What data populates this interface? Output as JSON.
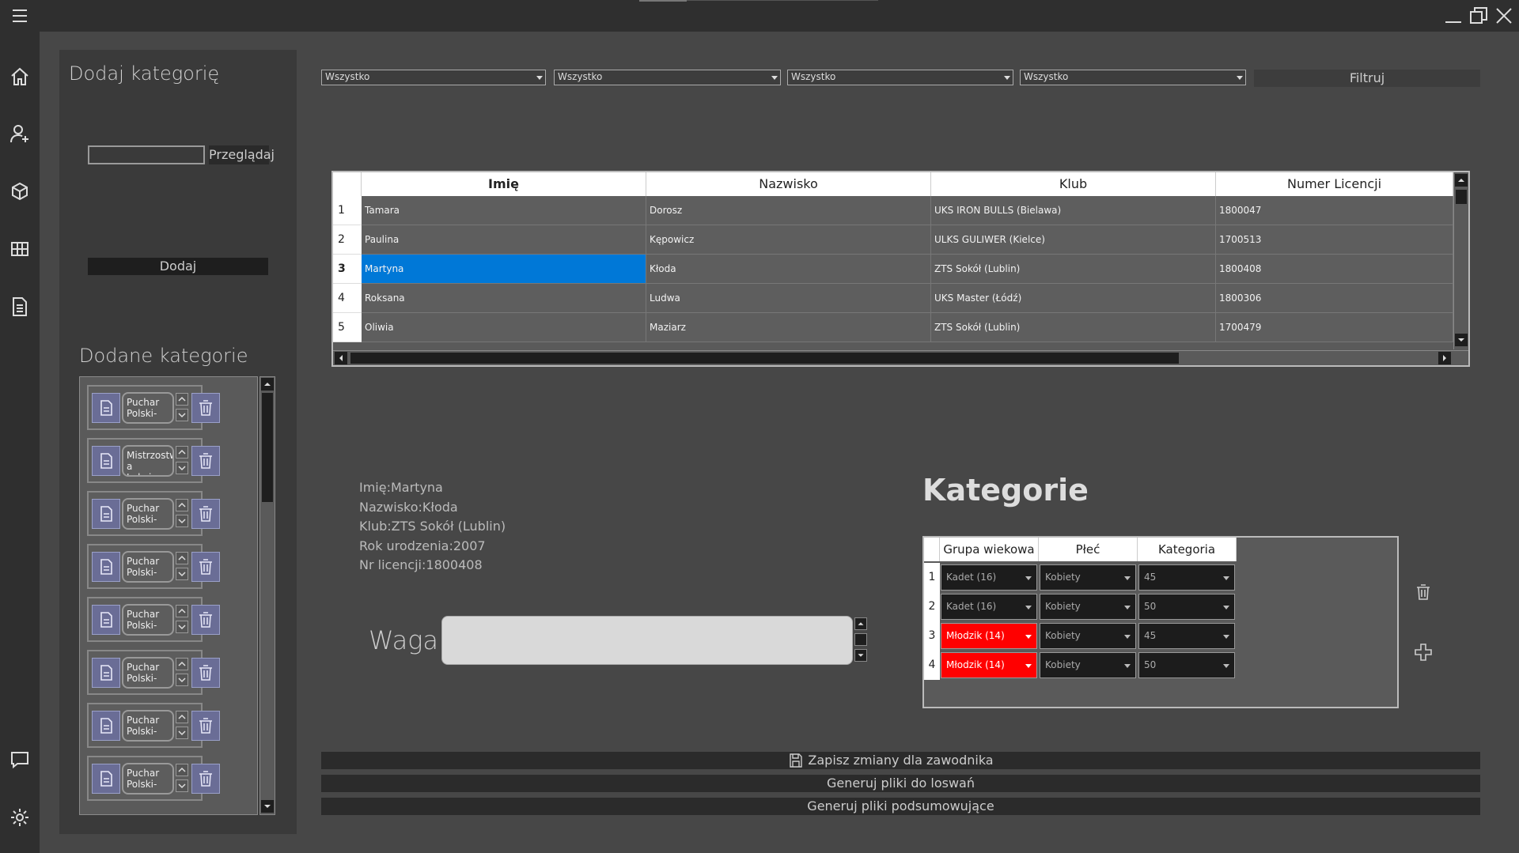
{
  "left_panel": {
    "title": "Dodaj kategorię",
    "file_input_value": "",
    "browse_label": "Przeglądaj",
    "add_label": "Dodaj",
    "added_title": "Dodane kategorie",
    "categories": [
      {
        "name": "Puchar Polski-"
      },
      {
        "name": "Mistrzostw a Lubziny-"
      },
      {
        "name": "Puchar Polski-"
      },
      {
        "name": "Puchar Polski-"
      },
      {
        "name": "Puchar Polski-"
      },
      {
        "name": "Puchar Polski-"
      },
      {
        "name": "Puchar Polski-"
      },
      {
        "name": "Puchar Polski-"
      }
    ]
  },
  "filters": {
    "values": [
      "Wszystko",
      "Wszystko",
      "Wszystko",
      "Wszystko"
    ],
    "button_label": "Filtruj"
  },
  "table": {
    "columns": [
      "Imię",
      "Nazwisko",
      "Klub",
      "Numer Licencji"
    ],
    "rows": [
      {
        "n": "1",
        "cells": [
          "Tamara",
          "Dorosz",
          "UKS IRON BULLS (Bielawa)",
          "1800047"
        ]
      },
      {
        "n": "2",
        "cells": [
          "Paulina",
          "Kępowicz",
          "ULKS GULIWER (Kielce)",
          "1700513"
        ]
      },
      {
        "n": "3",
        "cells": [
          "Martyna",
          "Kłoda",
          "ZTS Sokół (Lublin)",
          "1800408"
        ]
      },
      {
        "n": "4",
        "cells": [
          "Roksana",
          "Ludwa",
          "UKS Master (Łódź)",
          "1800306"
        ]
      },
      {
        "n": "5",
        "cells": [
          "Oliwia",
          "Maziarz",
          "ZTS Sokół (Lublin)",
          "1700479"
        ]
      }
    ]
  },
  "details": {
    "name": "Imię:Martyna",
    "surname": "Nazwisko:Kłoda",
    "club": "Klub:ZTS Sokół (Lublin)",
    "birth_year": "Rok urodzenia:2007",
    "license": "Nr licencji:1800408",
    "weight_label": "Waga",
    "weight_value": ""
  },
  "categories_section": {
    "title": "Kategorie",
    "columns": [
      "Grupa wiekowa",
      "Płeć",
      "Kategoria"
    ],
    "rows": [
      {
        "n": "1",
        "age": "Kadet (16)",
        "sex": "Kobiety",
        "cat": "45",
        "invalid": false
      },
      {
        "n": "2",
        "age": "Kadet (16)",
        "sex": "Kobiety",
        "cat": "50",
        "invalid": false
      },
      {
        "n": "3",
        "age": "Młodzik (14)",
        "sex": "Kobiety",
        "cat": "45",
        "invalid": true
      },
      {
        "n": "4",
        "age": "Młodzik (14)",
        "sex": "Kobiety",
        "cat": "50",
        "invalid": true
      }
    ]
  },
  "actions": {
    "save": "Zapisz zmiany dla zawodnika",
    "gen_draw": "Generuj pliki do loswań",
    "gen_summary": "Generuj pliki podsumowujące"
  },
  "colors": {
    "selection": "#0078d7",
    "invalid": "#ff0000",
    "icon_accent": "#6a6d96"
  }
}
